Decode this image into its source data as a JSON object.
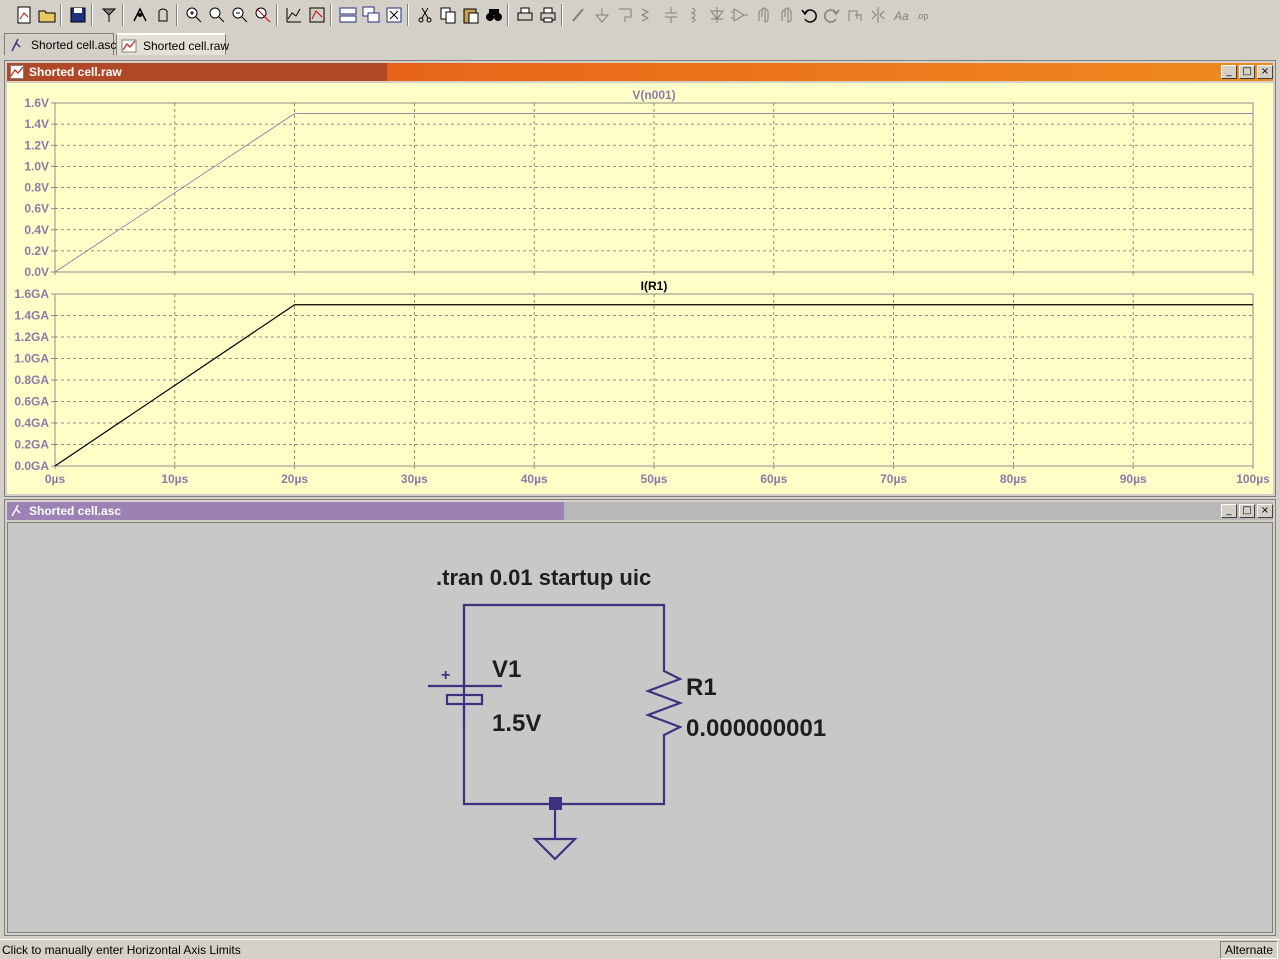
{
  "toolbar": {
    "buttons": [
      "new-schematic-icon",
      "open-icon",
      "save-icon",
      "control-panel-icon",
      "run-icon",
      "halt-icon",
      "zoom-in-icon",
      "zoom-rect-icon",
      "zoom-out-icon",
      "zoom-full-icon",
      "autorange-icon",
      "add-trace-icon",
      "tile-horizontal-icon",
      "cascade-icon",
      "close-all-icon",
      "cut-icon",
      "copy-icon",
      "paste-icon",
      "find-icon",
      "print-setup-icon",
      "print-icon",
      "draw-wire-icon",
      "ground-icon",
      "label-net-icon",
      "resistor-icon",
      "capacitor-icon",
      "inductor-icon",
      "diode-icon",
      "component-icon",
      "move-icon",
      "drag-icon",
      "undo-icon",
      "redo-icon",
      "rotate-icon",
      "mirror-icon",
      "text-icon",
      "spice-directive-icon"
    ]
  },
  "tabs": [
    {
      "label": "Shorted cell.asc",
      "icon": "schematic-icon",
      "active": false
    },
    {
      "label": "Shorted cell.raw",
      "icon": "waveform-icon",
      "active": true
    }
  ],
  "waveform_window": {
    "title": "Shorted cell.raw",
    "title_colors": [
      "#b04828",
      "#e86418",
      "#f08a20"
    ]
  },
  "schematic_window": {
    "title": "Shorted cell.asc",
    "title_color": "#9c82b4"
  },
  "window_controls": {
    "minimize": "_",
    "restore": "□",
    "close": "×"
  },
  "chart_data": [
    {
      "type": "line",
      "title": "V(n001)",
      "x": [
        0,
        20,
        100
      ],
      "x_unit": "µs",
      "xlim": [
        0,
        100
      ],
      "x_ticks": [
        "0µs",
        "10µs",
        "20µs",
        "30µs",
        "40µs",
        "50µs",
        "60µs",
        "70µs",
        "80µs",
        "90µs",
        "100µs"
      ],
      "series": [
        {
          "name": "V(n001)",
          "values": [
            0,
            1.5,
            1.5
          ],
          "color": "#8c7aa8"
        }
      ],
      "ylim": [
        0,
        1.6
      ],
      "y_ticks": [
        "0.0V",
        "0.2V",
        "0.4V",
        "0.6V",
        "0.8V",
        "1.0V",
        "1.2V",
        "1.4V",
        "1.6V"
      ],
      "grid": true
    },
    {
      "type": "line",
      "title": "I(R1)",
      "x": [
        0,
        20,
        100
      ],
      "x_unit": "µs",
      "xlim": [
        0,
        100
      ],
      "x_ticks": [
        "0µs",
        "10µs",
        "20µs",
        "30µs",
        "40µs",
        "50µs",
        "60µs",
        "70µs",
        "80µs",
        "90µs",
        "100µs"
      ],
      "series": [
        {
          "name": "I(R1)",
          "values": [
            0,
            1.5,
            1.5
          ],
          "color": "#000000"
        }
      ],
      "ylim": [
        0,
        1.6
      ],
      "y_ticks": [
        "0.0GA",
        "0.2GA",
        "0.4GA",
        "0.6GA",
        "0.8GA",
        "1.0GA",
        "1.2GA",
        "1.4GA",
        "1.6GA"
      ],
      "grid": true
    }
  ],
  "schematic": {
    "directive": ".tran 0.01 startup uic",
    "source_name": "V1",
    "source_value": "1.5V",
    "source_plus": "+",
    "resistor_name": "R1",
    "resistor_value": "0.000000001",
    "wire_color": "#3c3280"
  },
  "status": {
    "text": "Click to manually enter Horizontal Axis Limits",
    "mode": "Alternate"
  }
}
